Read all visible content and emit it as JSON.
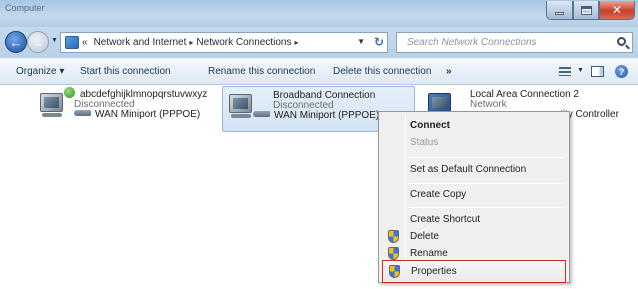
{
  "window": {
    "title": "Computer"
  },
  "address": {
    "crumbs": [
      "Network and Internet",
      "Network Connections"
    ],
    "prefix": "«",
    "separator": "▸",
    "search_placeholder": "Search Network Connections"
  },
  "toolbar": {
    "organize": "Organize ▾",
    "start": "Start this connection",
    "rename": "Rename this connection",
    "delete": "Delete this connection",
    "more": "»"
  },
  "connections": [
    {
      "name": "abcdefghijklmnopqrstuvwxyz",
      "status": "Disconnected",
      "device": "WAN Miniport (PPPOE)"
    },
    {
      "name": "Broadband Connection",
      "status": "Disconnected",
      "device": "WAN Miniport (PPPOE)"
    },
    {
      "name": "Local Area Connection 2",
      "status": "Network",
      "device_trail": "tity Controller"
    }
  ],
  "context_menu": {
    "items": [
      {
        "label": "Connect"
      },
      {
        "label": "Status"
      },
      {
        "label": "Set as Default Connection"
      },
      {
        "label": "Create Copy"
      },
      {
        "label": "Create Shortcut"
      },
      {
        "label": "Delete"
      },
      {
        "label": "Rename"
      },
      {
        "label": "Properties"
      }
    ]
  },
  "colors": {
    "highlight_border": "#ce2a2a",
    "selection_bg": "#dbe8f6",
    "titlebar": "#b9d0e8"
  }
}
